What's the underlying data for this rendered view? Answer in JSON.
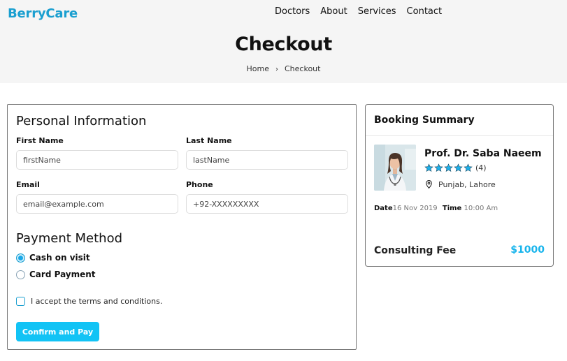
{
  "header": {
    "logo": "BerryCare",
    "nav": [
      "Doctors",
      "About",
      "Services",
      "Contact"
    ]
  },
  "hero": {
    "title": "Checkout",
    "breadcrumb": {
      "home": "Home",
      "separator": "›",
      "current": "Checkout"
    }
  },
  "personal_info": {
    "title": "Personal Information",
    "first_name": {
      "label": "First Name",
      "placeholder": "firstName"
    },
    "last_name": {
      "label": "Last Name",
      "placeholder": "lastName"
    },
    "email": {
      "label": "Email",
      "placeholder": "email@example.com"
    },
    "phone": {
      "label": "Phone",
      "placeholder": "+92-XXXXXXXXX"
    }
  },
  "payment": {
    "title": "Payment Method",
    "options": [
      {
        "label": "Cash on visit",
        "checked": true
      },
      {
        "label": "Card Payment",
        "checked": false
      }
    ],
    "terms_label": "I accept the terms and conditions.",
    "terms_checked": false,
    "confirm_label": "Confirm and Pay"
  },
  "summary": {
    "title": "Booking Summary",
    "doctor_name": "Prof. Dr. Saba Naeem",
    "rating": 5,
    "review_count": "(4)",
    "location": "Punjab, Lahore",
    "date_label": "Date",
    "date_value": "16 Nov 2019",
    "time_label": "Time",
    "time_value": "10:00 Am",
    "fee_label": "Consulting Fee",
    "fee_value": "$1000"
  },
  "colors": {
    "brand": "#1a9fd0",
    "button": "#12c3f5",
    "fee": "#17b4ec",
    "hero_bg": "#f5f5f5"
  }
}
